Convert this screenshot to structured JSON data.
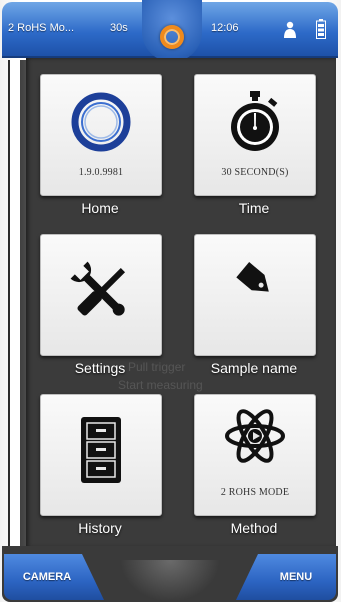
{
  "status_bar": {
    "mode": "2 RoHS Mo...",
    "timer": "30s",
    "clock": "12:06"
  },
  "tiles": [
    {
      "label": "Home",
      "value": "1.9.0.9981",
      "icon": "ring-logo-icon"
    },
    {
      "label": "Time",
      "value": "30 SECOND(S)",
      "icon": "stopwatch-icon"
    },
    {
      "label": "Settings",
      "value": "",
      "icon": "wrench-screwdriver-icon"
    },
    {
      "label": "Sample name",
      "value": "",
      "icon": "tag-icon"
    },
    {
      "label": "History",
      "value": "",
      "icon": "file-cabinet-icon"
    },
    {
      "label": "Method",
      "value": "2 ROHS MODE",
      "icon": "atom-icon"
    }
  ],
  "background_hint": {
    "line1": "Pull trigger",
    "line2": "Start measuring"
  },
  "bottom_bar": {
    "left_button": "CAMERA",
    "right_button": "MENU"
  },
  "colors": {
    "accent_blue": "#2d6ac8",
    "dial_orange": "#f08a1c",
    "panel_dark": "#3b3b3b"
  }
}
